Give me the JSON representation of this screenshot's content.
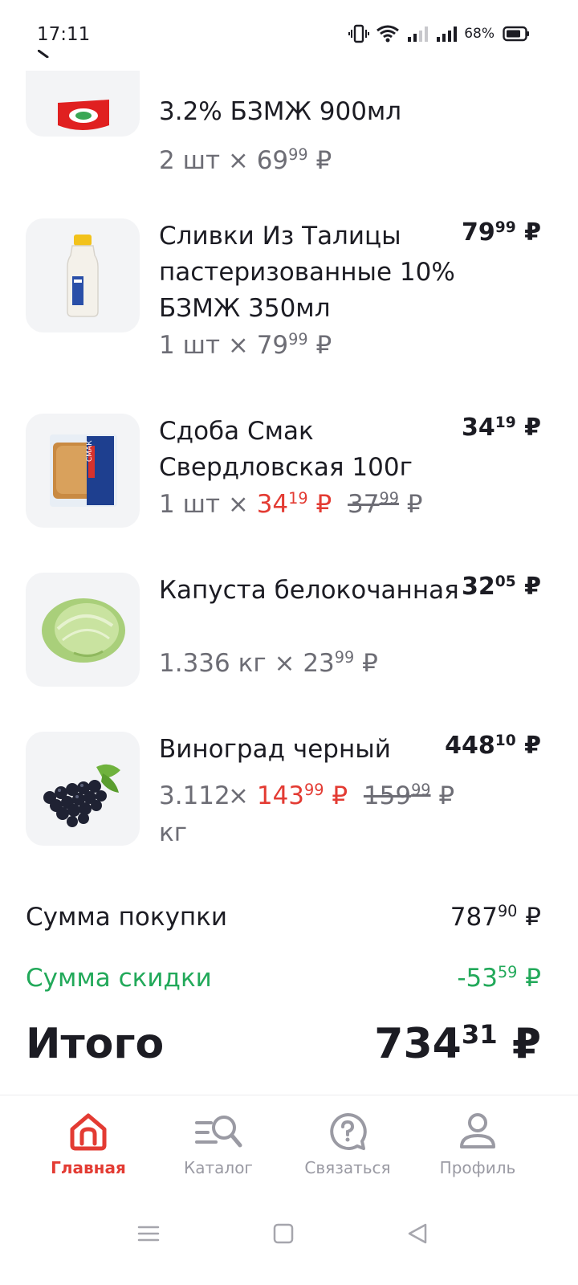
{
  "status_bar": {
    "time": "17:11",
    "battery_percent": "68%",
    "icons": [
      "vibrate-icon",
      "wifi-icon",
      "signal-icon",
      "signal-icon",
      "battery-icon"
    ]
  },
  "items": [
    {
      "name": "3.2% БЗМЖ 900мл",
      "qty_prefix": "2 шт ×",
      "unit_price_int": "69",
      "unit_price_frac": "99",
      "currency": "₽",
      "image": "milk-pack-image"
    },
    {
      "name": "Сливки Из Талицы пастеризованные 10% БЗМЖ 350мл",
      "qty_prefix": "1 шт ×",
      "unit_price_int": "79",
      "unit_price_frac": "99",
      "total_int": "79",
      "total_frac": "99",
      "currency": "₽",
      "image": "cream-bottle-image"
    },
    {
      "name": "Сдоба Смак Свердловская 100г",
      "qty_prefix": "1 шт ×",
      "unit_price_int": "34",
      "unit_price_frac": "19",
      "old_price_int": "37",
      "old_price_frac": "99",
      "total_int": "34",
      "total_frac": "19",
      "currency": "₽",
      "image": "bun-package-image",
      "package_text": "СМАК"
    },
    {
      "name": "Капуста белокочанная",
      "qty_prefix": "1.336 кг ×",
      "unit_price_int": "23",
      "unit_price_frac": "99",
      "total_int": "32",
      "total_frac": "05",
      "currency": "₽",
      "image": "cabbage-image"
    },
    {
      "name": "Виноград черный",
      "qty_amount": "3.112",
      "qty_unit": "кг",
      "qty_times": "×",
      "unit_price_int": "143",
      "unit_price_frac": "99",
      "old_price_int": "159",
      "old_price_frac": "99",
      "total_int": "448",
      "total_frac": "10",
      "currency": "₽",
      "image": "grapes-image"
    }
  ],
  "summary": {
    "purchase_label": "Сумма покупки",
    "purchase_int": "787",
    "purchase_frac": "90",
    "discount_label": "Сумма скидки",
    "discount_int": "-53",
    "discount_frac": "59",
    "total_label": "Итого",
    "total_int": "734",
    "total_frac": "31",
    "currency": "₽"
  },
  "bottom_nav": {
    "active": "home",
    "items": [
      {
        "label": "Главная",
        "icon": "home-icon"
      },
      {
        "label": "Каталог",
        "icon": "catalog-search-icon"
      },
      {
        "label": "Связаться",
        "icon": "help-chat-icon"
      },
      {
        "label": "Профиль",
        "icon": "profile-icon"
      }
    ]
  },
  "colors": {
    "accent_red": "#e33b33",
    "discount_green": "#22a95a",
    "text": "#1c1c23",
    "muted": "#6d6d75",
    "thumb_bg": "#f3f4f6"
  }
}
